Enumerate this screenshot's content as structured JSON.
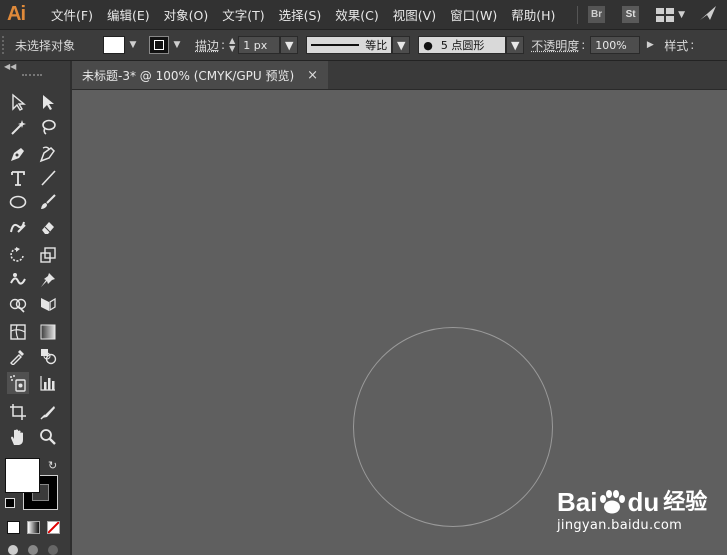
{
  "app": {
    "logo": "Ai"
  },
  "menubar": {
    "items": [
      "文件(F)",
      "编辑(E)",
      "对象(O)",
      "文字(T)",
      "选择(S)",
      "效果(C)",
      "视图(V)",
      "窗口(W)",
      "帮助(H)"
    ],
    "bridge_label": "Br",
    "stock_label": "St"
  },
  "control_bar": {
    "selection_status": "未选择对象",
    "stroke_label": "描边",
    "stroke_weight": "1 px",
    "profile_label": "等比",
    "brush_label": "5 点圆形",
    "opacity_label": "不透明度",
    "opacity_value": "100%",
    "style_label": "样式"
  },
  "document": {
    "tab_title": "未标题-3* @ 100% (CMYK/GPU 预览)",
    "close_glyph": "×"
  },
  "watermark": {
    "brand": "Bai",
    "brand_suffix": "du",
    "product": "经验",
    "url": "jingyan.baidu.com"
  },
  "colors": {
    "accent_logo": "#e08a3a",
    "canvas": "#5f5f5f",
    "fill": "#ffffff",
    "stroke": "#000000"
  }
}
